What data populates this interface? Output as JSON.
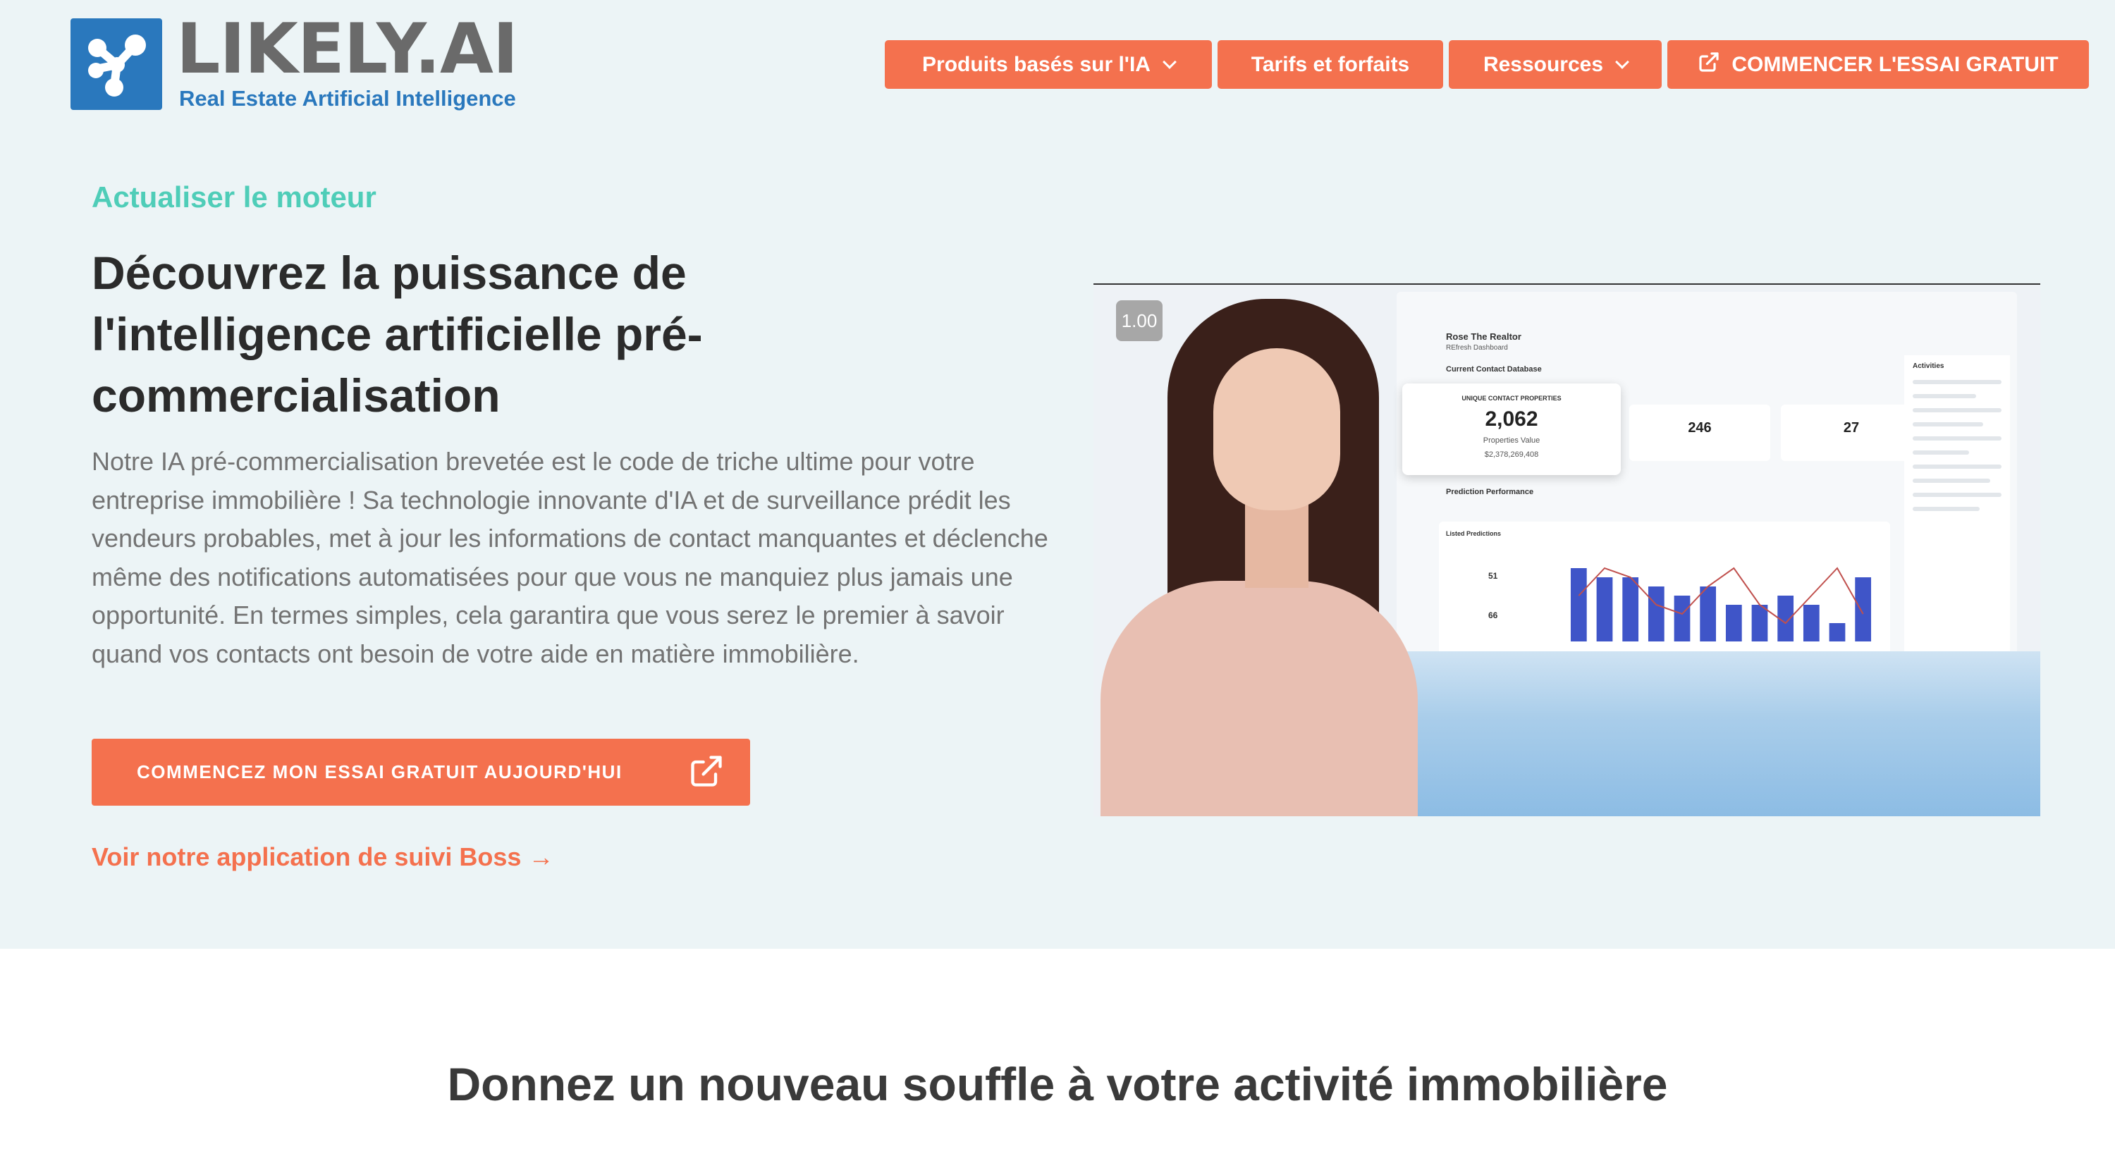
{
  "brand": {
    "name": "LIKELY.AI",
    "tagline": "Real Estate Artificial Intelligence",
    "logo_icon": "molecule-logo-icon",
    "color": "#2a78bd"
  },
  "nav": {
    "items": [
      {
        "label": "Produits basés sur l'IA",
        "icon": "chevron-down-icon"
      },
      {
        "label": "Tarifs et forfaits"
      },
      {
        "label": "Ressources",
        "icon": "chevron-down-icon"
      },
      {
        "label": "COMMENCER L'ESSAI GRATUIT",
        "icon": "external-link-icon"
      }
    ],
    "accent": "#f4714e"
  },
  "hero": {
    "eyebrow": "Actualiser le moteur",
    "headline": "Découvrez la puissance de l'intelligence artificielle pré-commercialisation",
    "description": "Notre IA pré-commercialisation brevetée est le code de triche ultime pour votre entreprise immobilière ! Sa technologie innovante d'IA et de surveillance prédit les vendeurs probables, met à jour les informations de contact manquantes et déclenche même des notifications automatisées pour que vous ne manquiez plus jamais une opportunité. En termes simples, cela garantira que vous serez le premier à savoir quand vos contacts ont besoin de votre aide en matière immobilière.",
    "cta_label": "COMMENCEZ MON ESSAI GRATUIT AUJOURD'HUI",
    "cta_icon": "external-link-icon",
    "secondary_link": "Voir notre application de suivi Boss →",
    "eyebrow_color": "#4fcdb8"
  },
  "video": {
    "speed": "1.00",
    "dashboard": {
      "title": "Rose The Realtor",
      "subtitle": "REfresh Dashboard",
      "section": "Current Contact Database",
      "kpi_main": {
        "label": "UNIQUE CONTACT PROPERTIES",
        "value": "2,062",
        "sub_label": "Properties Value",
        "sub_value": "$2,378,269,408"
      },
      "kpi_2": {
        "value": "246"
      },
      "kpi_3": {
        "value": "27"
      },
      "performance": "Prediction Performance",
      "listed_predictions": "Listed Predictions",
      "stat_1": "51",
      "stat_2": "66",
      "bars": [
        8,
        7,
        7,
        6,
        5,
        6,
        4,
        4,
        5,
        4,
        2,
        7
      ],
      "line": [
        5,
        8,
        7,
        4,
        3,
        6,
        8,
        4,
        2,
        5,
        8,
        3
      ],
      "activities": "Activities"
    }
  },
  "section2": {
    "title": "Donnez un nouveau souffle à votre activité immobilière"
  }
}
